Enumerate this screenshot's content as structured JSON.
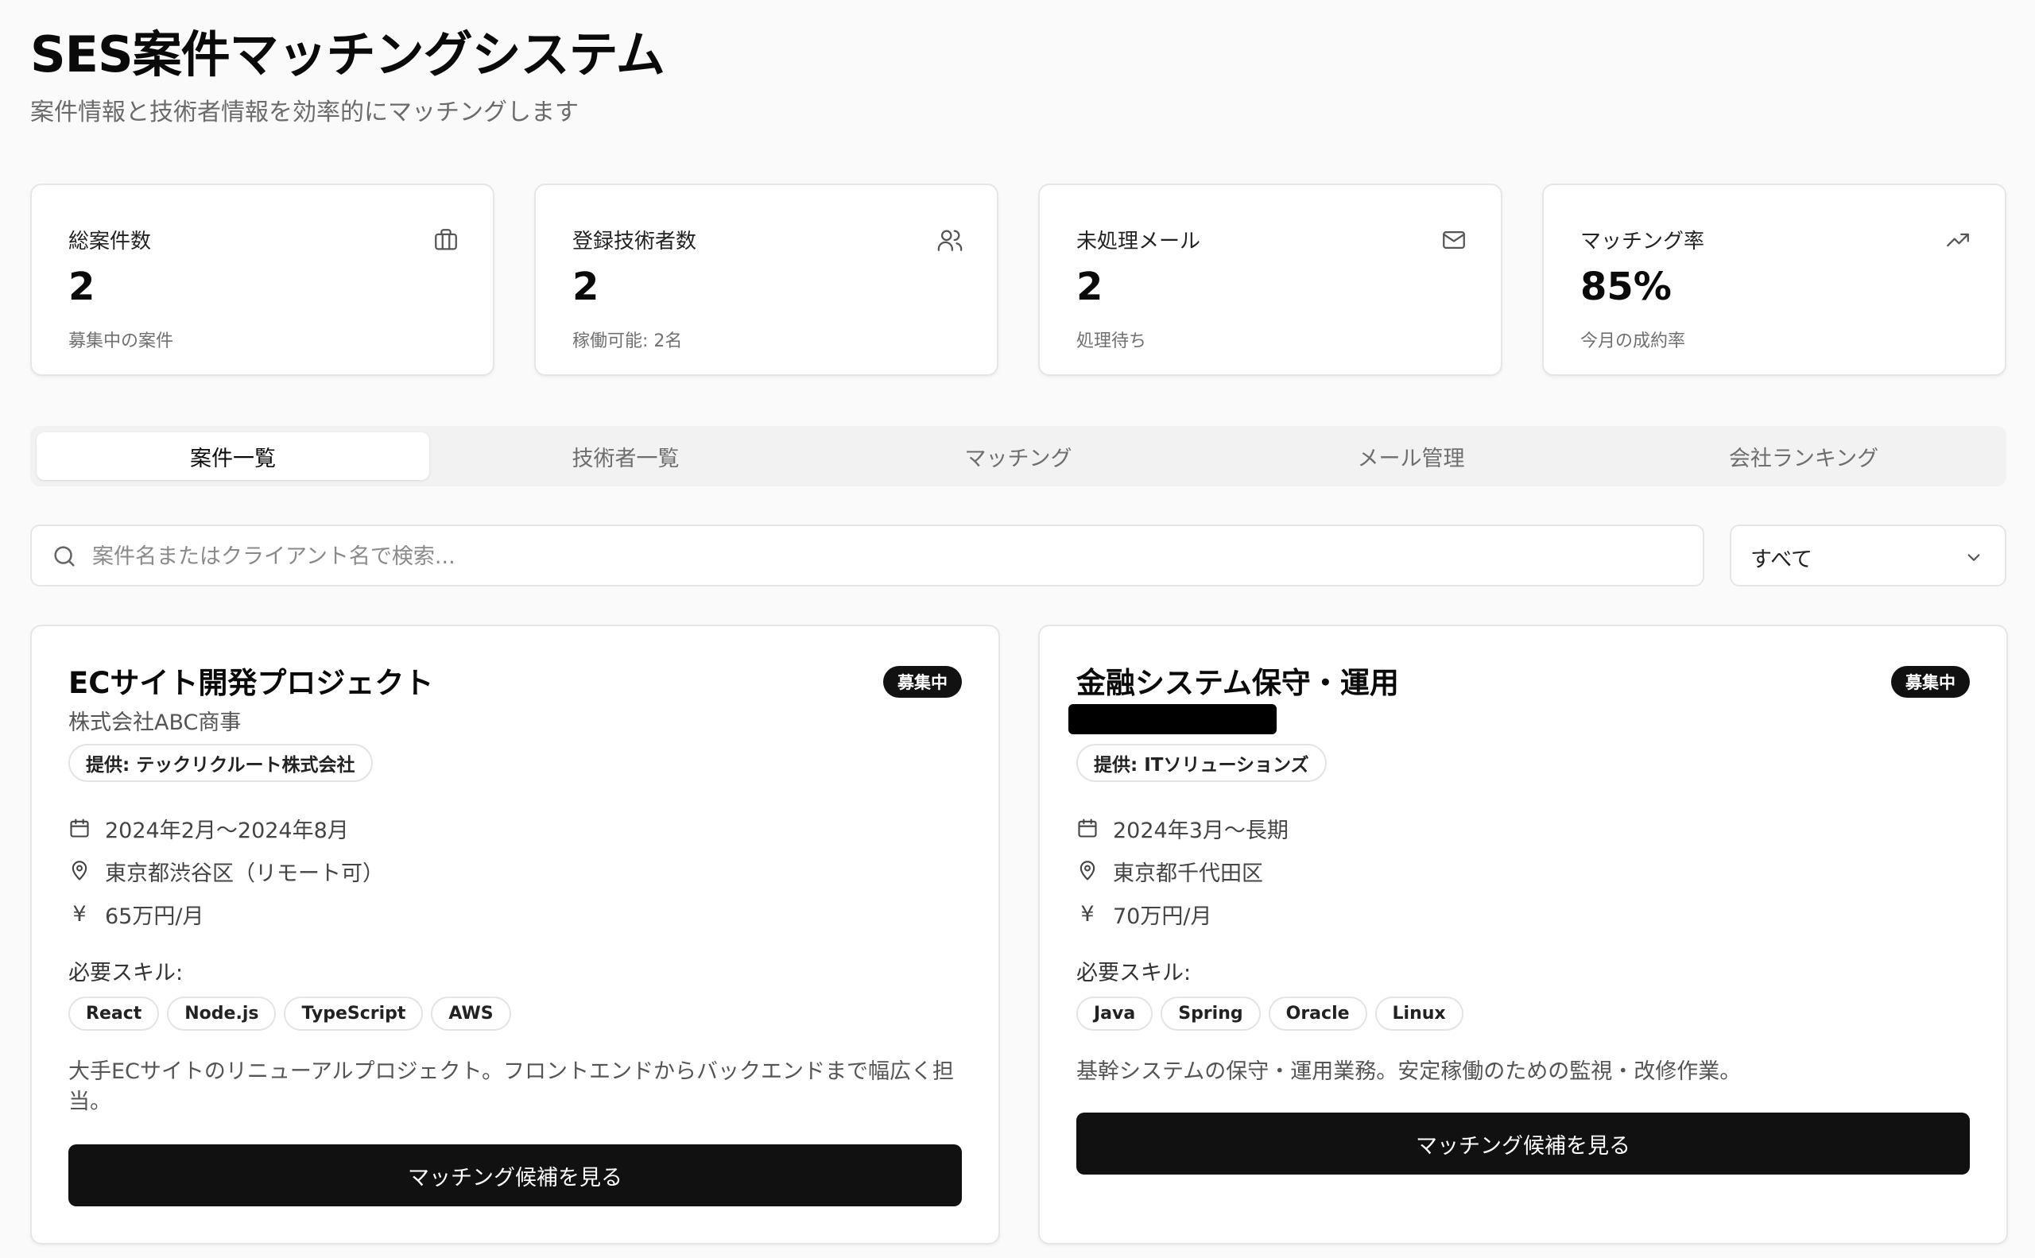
{
  "header": {
    "title": "SES案件マッチングシステム",
    "subtitle": "案件情報と技術者情報を効率的にマッチングします"
  },
  "stats": [
    {
      "label": "総案件数",
      "value": "2",
      "sub": "募集中の案件",
      "icon": "briefcase-icon"
    },
    {
      "label": "登録技術者数",
      "value": "2",
      "sub": "稼働可能: 2名",
      "icon": "users-icon"
    },
    {
      "label": "未処理メール",
      "value": "2",
      "sub": "処理待ち",
      "icon": "mail-icon"
    },
    {
      "label": "マッチング率",
      "value": "85%",
      "sub": "今月の成約率",
      "icon": "trending-up-icon"
    }
  ],
  "tabs": [
    {
      "label": "案件一覧",
      "active": true
    },
    {
      "label": "技術者一覧",
      "active": false
    },
    {
      "label": "マッチング",
      "active": false
    },
    {
      "label": "メール管理",
      "active": false
    },
    {
      "label": "会社ランキング",
      "active": false
    }
  ],
  "search": {
    "placeholder": "案件名またはクライアント名で検索..."
  },
  "filter": {
    "selected": "すべて"
  },
  "projects": [
    {
      "title": "ECサイト開発プロジェクト",
      "status": "募集中",
      "client": "株式会社ABC商事",
      "provider": "提供: テックリクルート株式会社",
      "period": "2024年2月～2024年8月",
      "location": "東京都渋谷区（リモート可）",
      "rate": "65万円/月",
      "skills_label": "必要スキル:",
      "skills": [
        "React",
        "Node.js",
        "TypeScript",
        "AWS"
      ],
      "description": "大手ECサイトのリニューアルプロジェクト。フロントエンドからバックエンドまで幅広く担当。",
      "button_label": "マッチング候補を見る"
    },
    {
      "title": "金融システム保守・運用",
      "status": "募集中",
      "client": "",
      "provider": "提供: ITソリューションズ",
      "period": "2024年3月～長期",
      "location": "東京都千代田区",
      "rate": "70万円/月",
      "skills_label": "必要スキル:",
      "skills": [
        "Java",
        "Spring",
        "Oracle",
        "Linux"
      ],
      "description": "基幹システムの保守・運用業務。安定稼働のための監視・改修作業。",
      "button_label": "マッチング候補を見る"
    }
  ]
}
